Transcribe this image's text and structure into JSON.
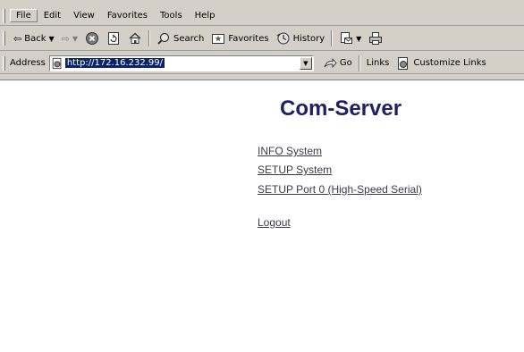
{
  "menu": [
    "File",
    "Edit",
    "View",
    "Favorites",
    "Tools",
    "Help"
  ],
  "toolbar": {
    "back": "Back",
    "search": "Search",
    "favorites": "Favorites",
    "history": "History"
  },
  "address_bar": {
    "label": "Address",
    "url": "http://172.16.232.99/",
    "go": "Go",
    "links": "Links",
    "customize": "Customize Links"
  },
  "page": {
    "title": "Com-Server",
    "links": [
      "INFO System",
      "SETUP System",
      "SETUP Port 0 (High-Speed Serial)",
      "Logout"
    ]
  }
}
